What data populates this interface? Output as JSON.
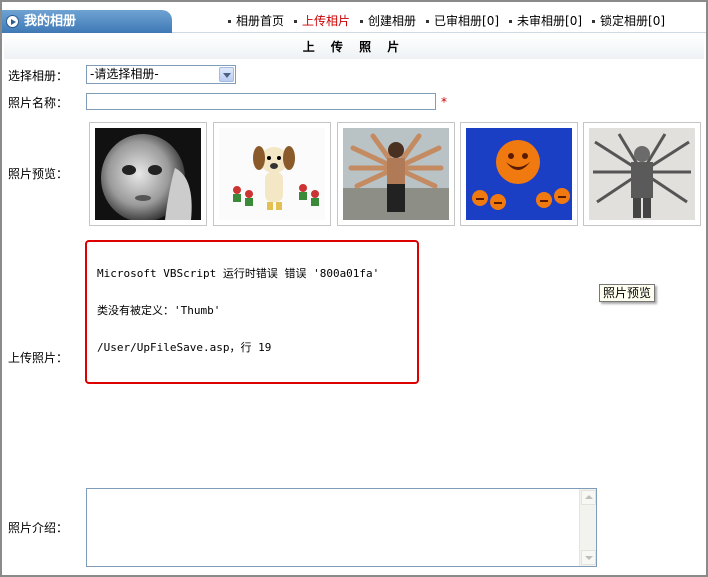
{
  "header": {
    "album_tab": "我的相册",
    "nav": [
      {
        "label": "相册首页"
      },
      {
        "label": "上传相片",
        "active": true
      },
      {
        "label": "创建相册"
      },
      {
        "label": "已审相册[0]"
      },
      {
        "label": "未审相册[0]"
      },
      {
        "label": "锁定相册[0]"
      }
    ]
  },
  "form": {
    "title": "上 传 照 片",
    "select_album": {
      "label": "选择相册：",
      "value": "-请选择相册-"
    },
    "photo_name": {
      "label": "照片名称：",
      "value": "",
      "required_mark": "*"
    },
    "preview": {
      "label": "照片预览：",
      "tooltip": "照片预览"
    },
    "upload": {
      "label": "上传照片："
    },
    "intro": {
      "label": "照片介绍：",
      "value": ""
    }
  },
  "error": {
    "line1": "Microsoft VBScript 运行时错误 错误 '800a01fa'",
    "line2": "类没有被定义：'Thumb'",
    "line3": "/User/UpFileSave.asp，行 19"
  },
  "thumbnails": [
    {
      "name": "baby-photo"
    },
    {
      "name": "cartoon-dog-photo"
    },
    {
      "name": "many-arms-man-photo"
    },
    {
      "name": "carved-oranges-photo"
    },
    {
      "name": "soldier-guns-photo"
    }
  ],
  "colors": {
    "accent_tab": "#3e79b6",
    "active_nav": "#cc0000",
    "error_border": "#dd0000"
  }
}
